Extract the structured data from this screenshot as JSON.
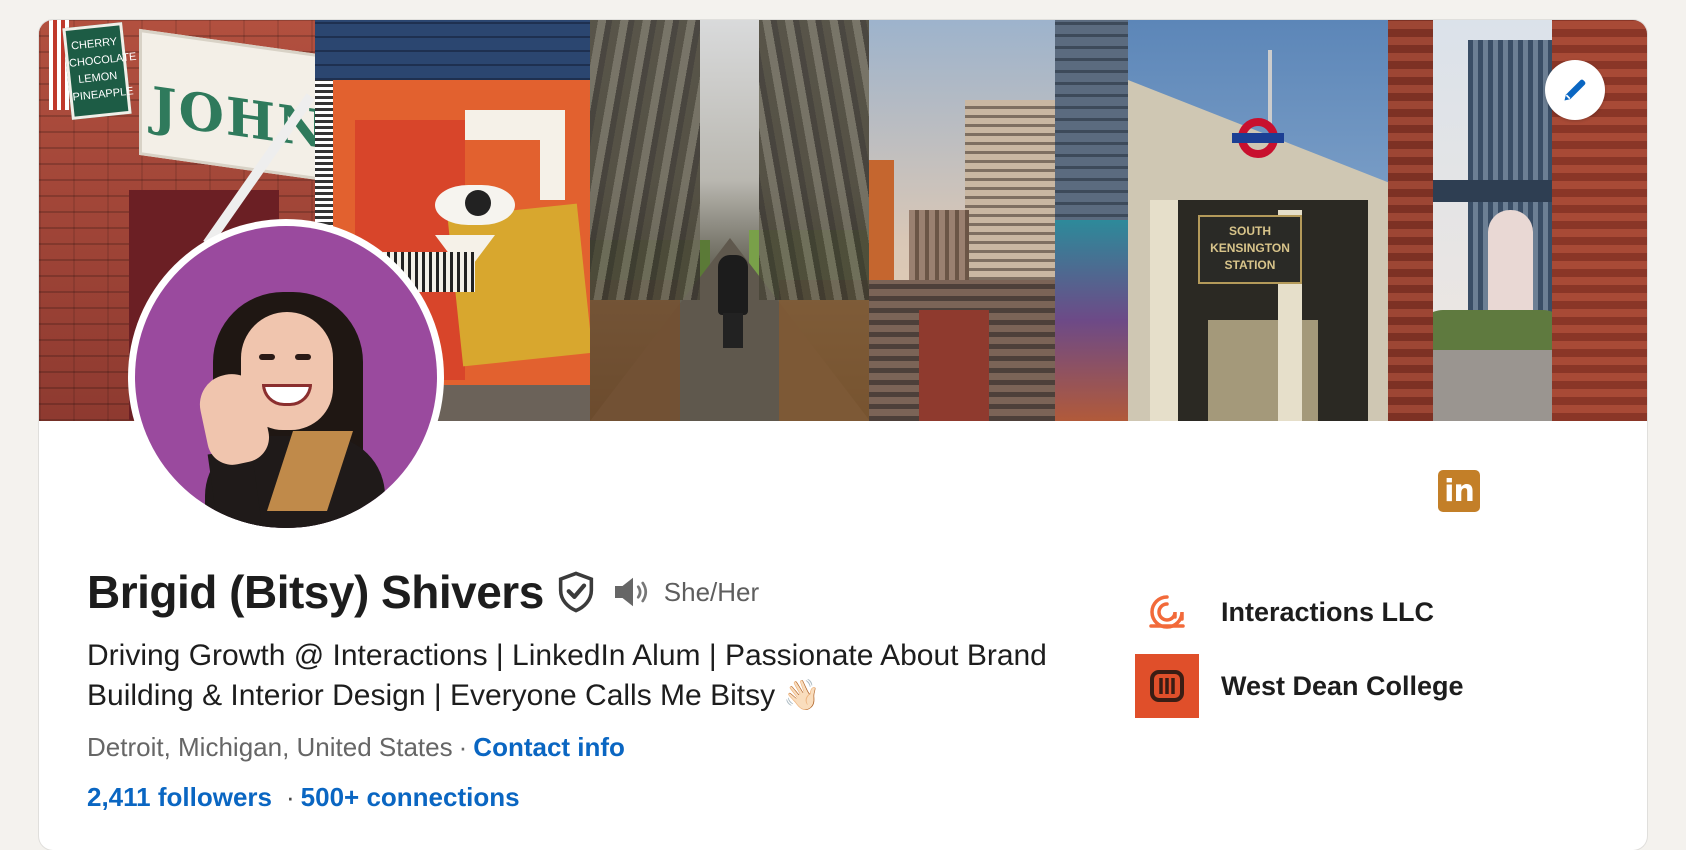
{
  "profile": {
    "name": "Brigid (Bitsy) Shivers",
    "pronouns": "She/Her",
    "headline": "Driving Growth @ Interactions | LinkedIn Alum | Passionate About Brand Building & Interior Design | Everyone Calls Me Bitsy 👋🏻",
    "location": "Detroit, Michigan, United States",
    "location_separator": "·",
    "contact_info_label": "Contact info",
    "followers_label": "2,411 followers",
    "stats_separator": "·",
    "connections_label": "500+ connections"
  },
  "banner": {
    "storefront_sign": "JOHN'S",
    "flavors_sign": "CHERRY CHOCOLATE LEMON PINEAPPLE",
    "station_sign": "SOUTH KENSINGTON STATION"
  },
  "companies": [
    {
      "name": "Interactions LLC",
      "logo": "interactions-logo",
      "color": "#f26a3a"
    },
    {
      "name": "West Dean College",
      "logo": "west-dean-college-logo",
      "color": "#e04f2a"
    }
  ],
  "badges": {
    "linkedin_badge_text": "in"
  },
  "icons": {
    "edit": "pencil-icon",
    "verified": "shield-check-icon",
    "pronunciation": "speaker-icon"
  },
  "colors": {
    "link": "#0a66c2",
    "background": "#f4f2ee",
    "card": "#ffffff",
    "linkedin_badge": "#c37f28"
  }
}
